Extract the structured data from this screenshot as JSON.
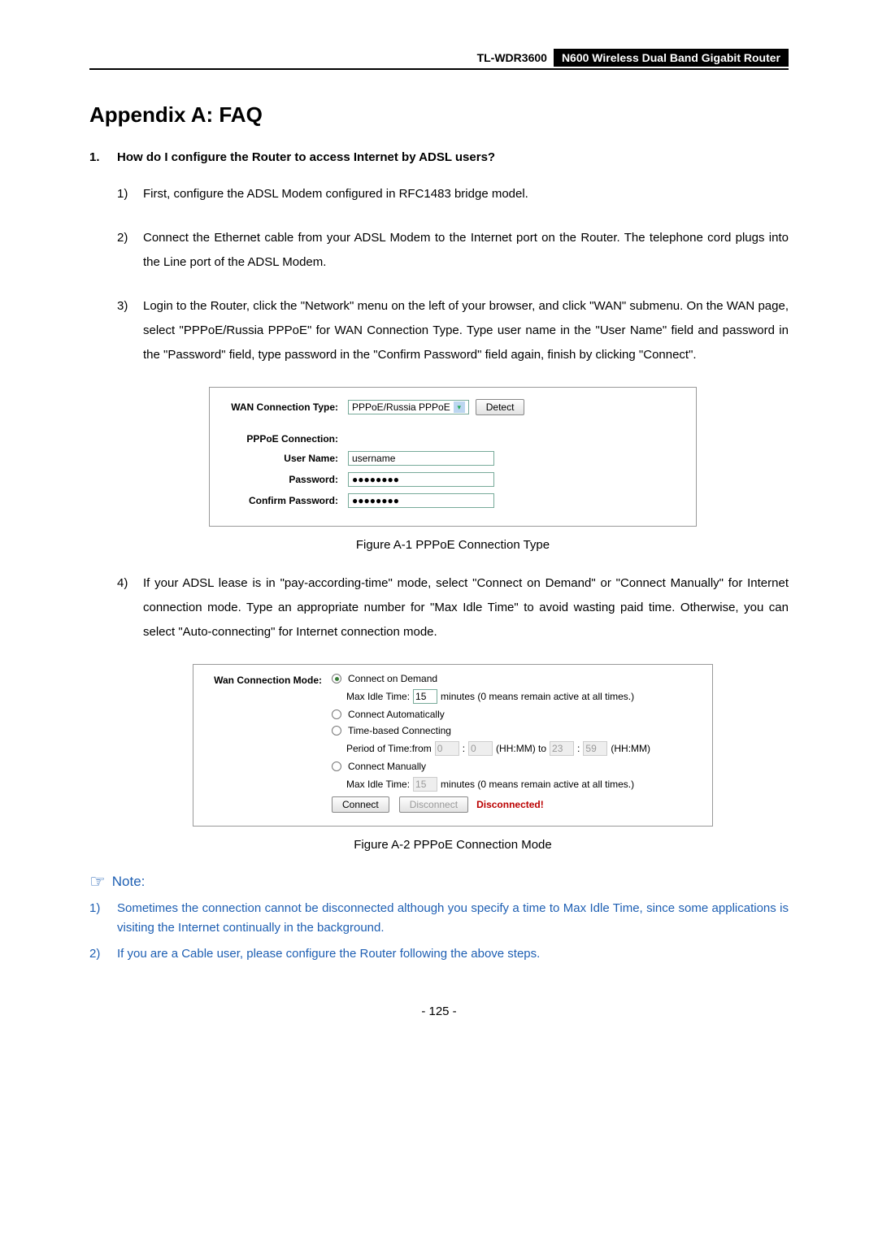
{
  "header": {
    "model": "TL-WDR3600",
    "product": "N600 Wireless Dual Band Gigabit Router"
  },
  "title": "Appendix A: FAQ",
  "question": {
    "num": "1.",
    "text": "How do I configure the Router to access Internet by ADSL users?"
  },
  "steps": [
    {
      "num": "1)",
      "text": "First, configure the ADSL Modem configured in RFC1483 bridge model."
    },
    {
      "num": "2)",
      "text": "Connect the Ethernet cable from your ADSL Modem to the Internet port on the Router. The telephone cord plugs into the Line port of the ADSL Modem."
    },
    {
      "num": "3)",
      "text": "Login to the Router, click the \"Network\" menu on the left of your browser, and click \"WAN\" submenu. On the WAN page, select \"PPPoE/Russia PPPoE\" for WAN Connection Type. Type user name in the \"User Name\" field and password in the \"Password\" field, type password in the \"Confirm Password\" field again, finish by clicking \"Connect\"."
    }
  ],
  "figure1": {
    "labels": {
      "wanType": "WAN Connection Type:",
      "pppoeConn": "PPPoE Connection:",
      "username": "User Name:",
      "password": "Password:",
      "confirm": "Confirm Password:"
    },
    "values": {
      "wanTypeSelect": "PPPoE/Russia PPPoE",
      "detectBtn": "Detect",
      "usernameVal": "username",
      "passwordVal": "●●●●●●●●",
      "confirmVal": "●●●●●●●●"
    },
    "caption": "Figure A-1 PPPoE Connection Type"
  },
  "step4": {
    "num": "4)",
    "text": "If your ADSL lease is in \"pay-according-time\" mode, select \"Connect on Demand\" or \"Connect Manually\" for Internet connection mode. Type an appropriate number for \"Max Idle Time\" to avoid wasting paid time. Otherwise, you can select \"Auto-connecting\" for Internet connection mode."
  },
  "figure2": {
    "label": "Wan Connection Mode:",
    "options": {
      "onDemand": "Connect on Demand",
      "maxIdleLabel": "Max Idle Time:",
      "maxIdleVal": "15",
      "maxIdleSuffix": "minutes (0 means remain active at all times.)",
      "auto": "Connect Automatically",
      "timeBased": "Time-based Connecting",
      "periodLabel": "Period of Time:from",
      "p1": "0",
      "p2": "0",
      "hhmmTo": "(HH:MM) to",
      "p3": "23",
      "p4": "59",
      "hhmm": "(HH:MM)",
      "manually": "Connect Manually",
      "maxIdle2Val": "15",
      "connectBtn": "Connect",
      "disconnectBtn": "Disconnect",
      "status": "Disconnected!"
    },
    "caption": "Figure A-2 PPPoE Connection Mode"
  },
  "note": {
    "heading": "Note:",
    "items": [
      {
        "num": "1)",
        "text": "Sometimes the connection cannot be disconnected although you specify a time to Max Idle Time, since some applications is visiting the Internet continually in the background."
      },
      {
        "num": "2)",
        "text": "If you are a Cable user, please configure the Router following the above steps."
      }
    ]
  },
  "pageNum": "- 125 -"
}
